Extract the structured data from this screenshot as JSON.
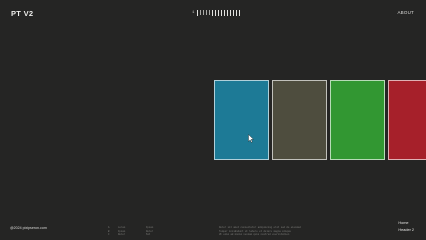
{
  "header": {
    "logo": "PT V2",
    "nav_about": "ABOUT",
    "ticker_label": "1"
  },
  "cards": [
    {
      "color": "#1d7a96"
    },
    {
      "color": "#4e4d3e"
    },
    {
      "color": "#329732"
    },
    {
      "color": "#a6202a"
    }
  ],
  "footer": {
    "copyright": "@2024 pixipseron.com",
    "links": [
      "Home",
      "Header 2"
    ],
    "rows": [
      [
        "A",
        "Lorem",
        "Ipsum",
        "Dolor sit amet consectetur adipiscing elit sed do eiusmod"
      ],
      [
        "B",
        "Ipsum",
        "Dolor",
        "Tempor incididunt ut labore et dolore magna aliqua"
      ],
      [
        "C",
        "Dolor",
        "Sit",
        "Ut enim ad minim veniam quis nostrud exercitation"
      ]
    ]
  }
}
